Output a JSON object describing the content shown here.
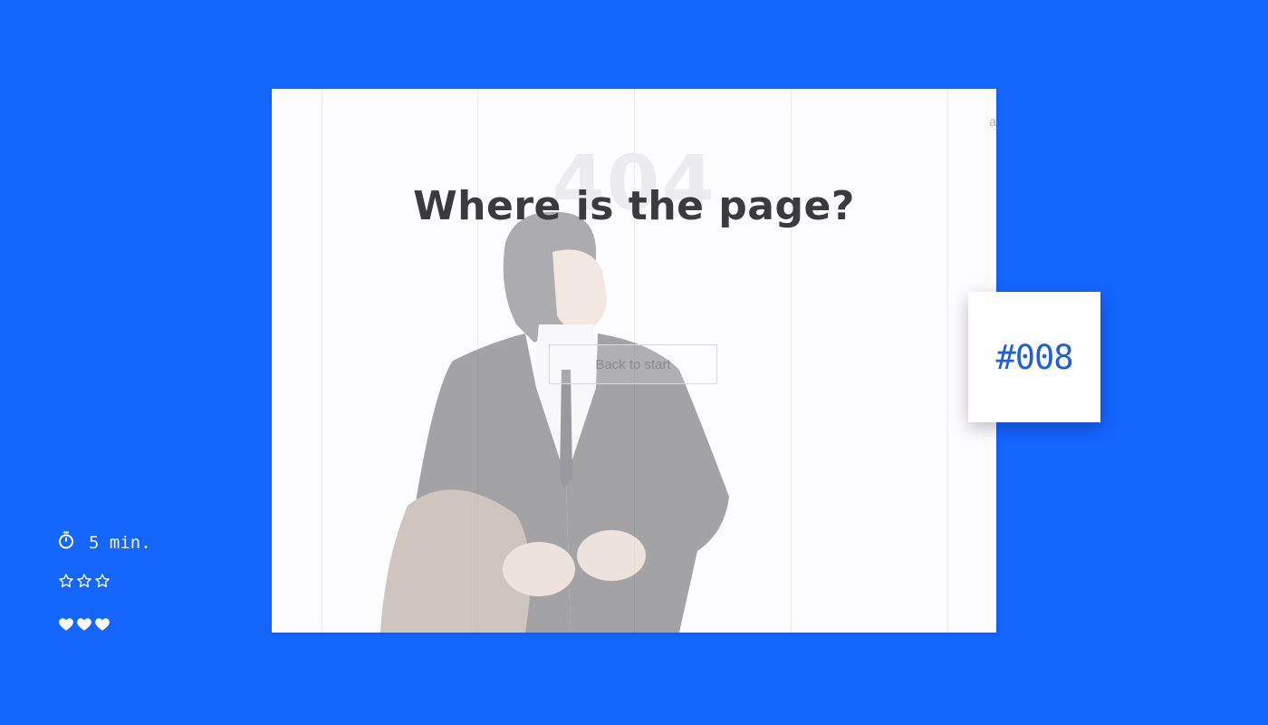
{
  "page": {
    "background_color": "#1565ff",
    "watermark_number": "404",
    "headline": "Where is the page?",
    "back_button_label": "Back to start",
    "corner_text": "a"
  },
  "tag": {
    "label": "#008",
    "color": "#1f5fd9"
  },
  "meta": {
    "time_icon": "stopwatch-icon",
    "time_label": "5 min.",
    "difficulty_icons": [
      "star-outline-icon",
      "star-outline-icon",
      "star-outline-icon"
    ],
    "likes_icons": [
      "heart-icon",
      "heart-icon",
      "heart-icon"
    ]
  }
}
